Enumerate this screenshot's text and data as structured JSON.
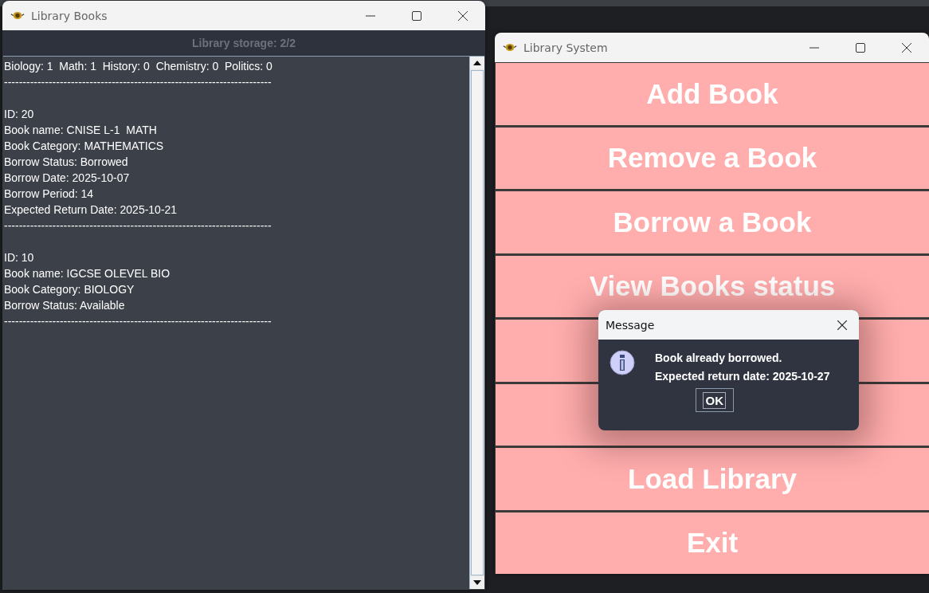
{
  "books_window": {
    "title": "Library Books",
    "header": "Library storage: 2/2",
    "summary": {
      "text": "Biology: 1  Math: 1  History: 0  Chemistry: 0  Politics: 0",
      "separator": "------------------------------------------------------------------------"
    },
    "books": [
      {
        "fields": [
          "ID: 20",
          "Book name: CNISE L-1  MATH",
          "Book Category: MATHEMATICS",
          "Borrow Status: Borrowed",
          "Borrow Date: 2025-10-07",
          "Borrow Period: 14",
          "Expected Return Date: 2025-10-21"
        ],
        "separator": "------------------------------------------------------------------------"
      },
      {
        "fields": [
          "ID: 10",
          "Book name: IGCSE OLEVEL BIO",
          "Book Category: BIOLOGY",
          "Borrow Status: Available"
        ],
        "separator": "------------------------------------------------------------------------"
      }
    ]
  },
  "system_window": {
    "title": "Library System",
    "buttons": [
      {
        "kind": "labeled",
        "label": "Add Book"
      },
      {
        "kind": "labeled",
        "label": "Remove a Book"
      },
      {
        "kind": "labeled",
        "label": "Borrow a Book"
      },
      {
        "kind": "labeled",
        "label": "View Books status"
      },
      {
        "kind": "covered"
      },
      {
        "kind": "covered"
      },
      {
        "kind": "labeled",
        "label": "Load Library"
      },
      {
        "kind": "labeled",
        "label": "Exit"
      }
    ]
  },
  "dialog": {
    "title": "Message",
    "lines": [
      "Book already borrowed.",
      "Expected return date: 2025-10-27"
    ],
    "button": "OK"
  }
}
